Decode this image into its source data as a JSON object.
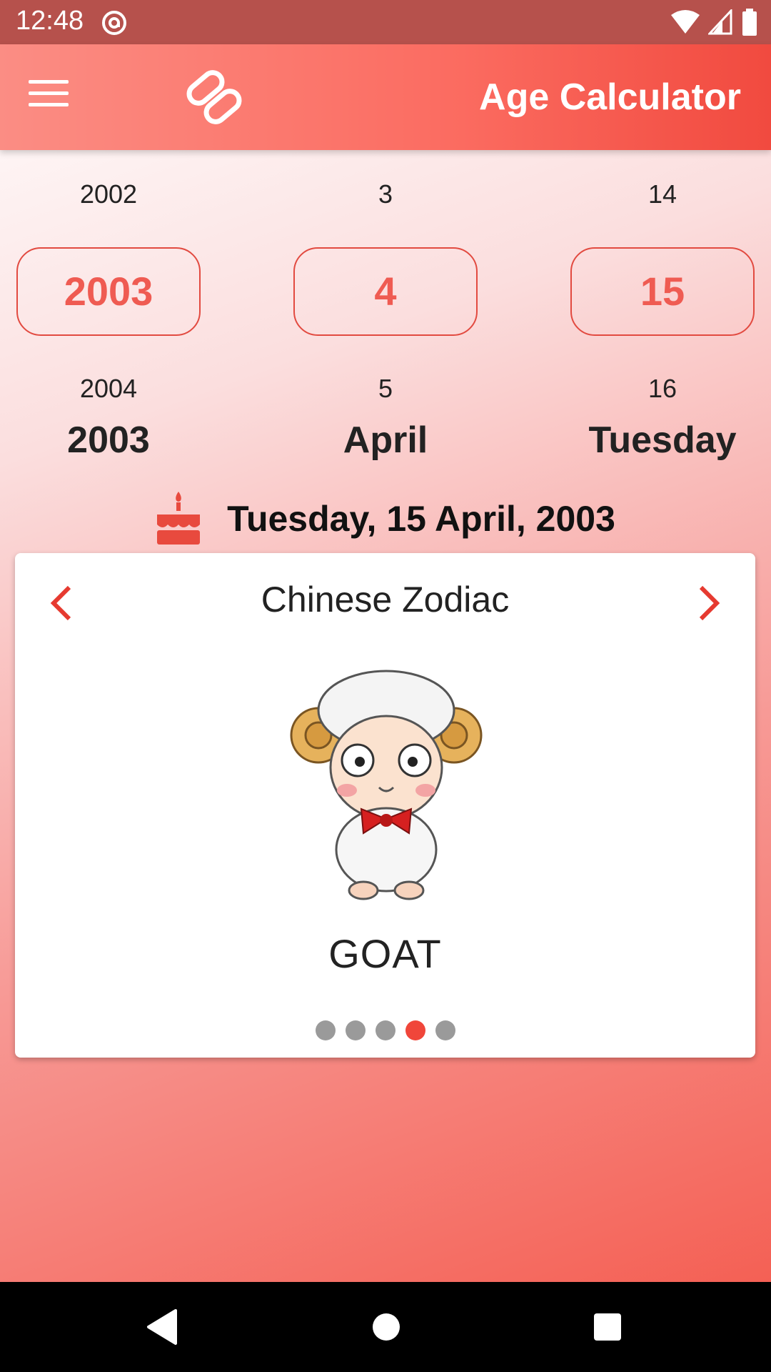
{
  "status_bar": {
    "time": "12:48",
    "icons": [
      "at-icon",
      "wifi-icon",
      "cell-signal-icon",
      "battery-icon"
    ]
  },
  "app_bar": {
    "title": "Age Calculator",
    "menu_icon": "hamburger-menu-icon",
    "logo_icon": "app-logo-icon",
    "color": "#fb6b60"
  },
  "picker": {
    "year": {
      "prev": "2002",
      "selected": "2003",
      "next": "2004",
      "label": "2003"
    },
    "month": {
      "prev": "3",
      "selected": "4",
      "next": "5",
      "label": "April"
    },
    "day": {
      "prev": "14",
      "selected": "15",
      "next": "16",
      "label": "Tuesday"
    }
  },
  "summary": {
    "icon": "birthday-cake-icon",
    "date_text": "Tuesday, 15 April, 2003"
  },
  "zodiac_card": {
    "title": "Chinese Zodiac",
    "animal": "GOAT",
    "image_icon": "goat-illustration",
    "page_count": 5,
    "active_page": 4,
    "accent_color": "#f0463a"
  },
  "nav_bar": {
    "buttons": [
      "back-icon",
      "home-icon",
      "recents-icon"
    ]
  }
}
